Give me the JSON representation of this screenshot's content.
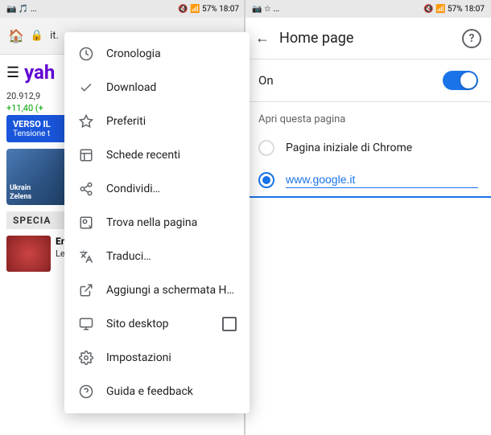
{
  "left_status": {
    "icons_left": "📷 🎵 ...",
    "icons_right": "🔇 📶 57% 18:07"
  },
  "right_status": {
    "icons_left": "📷 ☆ ...",
    "icons_right": "🔇 📶 57% 18:07"
  },
  "browser": {
    "address": "it.",
    "yahoo_logo": "yah",
    "stock_number": "20.912,9",
    "stock_change": "+11,40 (+",
    "blue_banner": "VERSO IL",
    "blue_sub": "Tensione t",
    "news_img_line1": "Ukrain",
    "news_img_line2": "Zelens",
    "special": "SPECIA",
    "corona_title": "Emergenza Coronavirus",
    "corona_sub": "Le ultime notizie sulla diffusione del"
  },
  "menu": {
    "items": [
      {
        "id": "cronologia",
        "icon": "🕐",
        "label": "Cronologia"
      },
      {
        "id": "download",
        "icon": "✓",
        "label": "Download"
      },
      {
        "id": "preferiti",
        "icon": "★",
        "label": "Preferiti"
      },
      {
        "id": "schede-recenti",
        "icon": "⊡",
        "label": "Schede recenti"
      },
      {
        "id": "condividi",
        "icon": "↗",
        "label": "Condividi…"
      },
      {
        "id": "trova-pagina",
        "icon": "🔍",
        "label": "Trova nella pagina"
      },
      {
        "id": "traduci",
        "icon": "T",
        "label": "Traduci…"
      },
      {
        "id": "aggiungi",
        "icon": "⤴",
        "label": "Aggiungi a schermata H…"
      },
      {
        "id": "sito-desktop",
        "icon": "🖥",
        "label": "Sito desktop",
        "has_checkbox": true
      },
      {
        "id": "impostazioni",
        "icon": "⚙",
        "label": "Impostazioni"
      },
      {
        "id": "guida",
        "icon": "?",
        "label": "Guida e feedback"
      }
    ]
  },
  "settings": {
    "title": "Home page",
    "toggle_label": "On",
    "toggle_on": true,
    "section_label": "Apri questa pagina",
    "option1": "Pagina iniziale di Chrome",
    "option2": "www.google.it",
    "back_label": "←",
    "help_label": "?"
  }
}
